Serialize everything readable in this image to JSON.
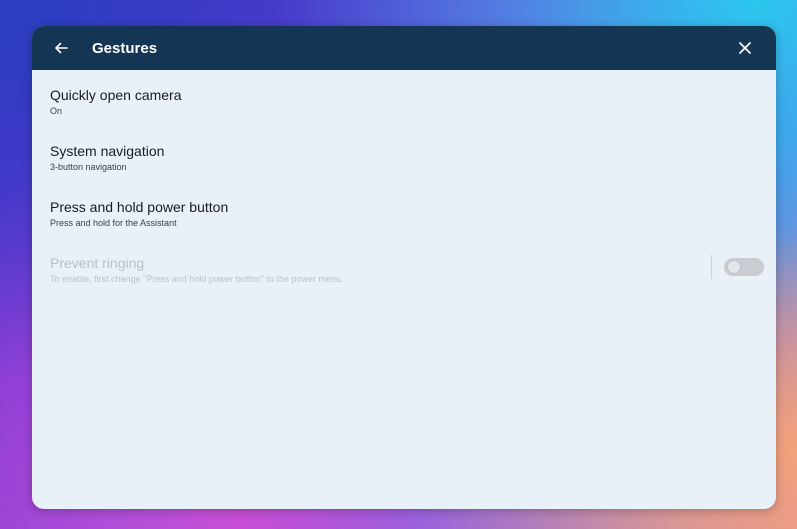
{
  "header": {
    "title": "Gestures",
    "back_icon": "arrow-left-icon",
    "close_icon": "close-icon"
  },
  "items": [
    {
      "primary": "Quickly open camera",
      "secondary": "On"
    },
    {
      "primary": "System navigation",
      "secondary": "3-button navigation"
    },
    {
      "primary": "Press and hold power button",
      "secondary": "Press and hold for the Assistant"
    },
    {
      "primary": "Prevent ringing",
      "secondary": "To enable, first change \"Press and hold power button\" to the power menu.",
      "disabled": true,
      "toggle": "off"
    }
  ],
  "colors": {
    "header_bg": "#143553",
    "dialog_bg": "#e8f0f8"
  }
}
